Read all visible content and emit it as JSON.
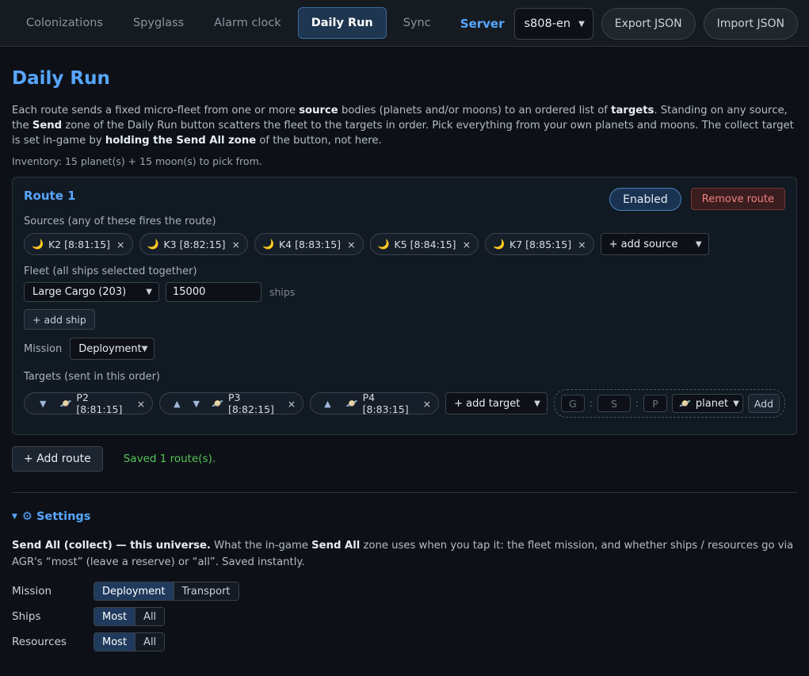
{
  "nav": {
    "tabs": [
      {
        "label": "Colonizations",
        "active": false
      },
      {
        "label": "Spyglass",
        "active": false
      },
      {
        "label": "Alarm clock",
        "active": false
      },
      {
        "label": "Daily Run",
        "active": true
      },
      {
        "label": "Sync",
        "active": false
      }
    ],
    "server_label": "Server",
    "server_value": "s808-en",
    "export_label": "Export JSON",
    "import_label": "Import JSON"
  },
  "page": {
    "title": "Daily Run",
    "intro": {
      "p1": "Each route sends a fixed micro-fleet from one or more ",
      "b1": "source",
      "p2": " bodies (planets and/or moons) to an ordered list of ",
      "b2": "targets",
      "p3": ". Standing on any source, the ",
      "b3": "Send",
      "p4": " zone of the Daily Run button scatters the fleet to the targets in order. Pick everything from your own planets and moons. The collect target is set in-game by ",
      "b4": "holding the Send All zone",
      "p5": " of the button, not here."
    },
    "inventory": "Inventory: 15 planet(s) + 15 moon(s) to pick from."
  },
  "route": {
    "title": "Route 1",
    "enabled_label": "Enabled",
    "remove_label": "Remove route",
    "sources_label": "Sources (any of these fires the route)",
    "sources": [
      {
        "label": "K2 [8:81:15]",
        "icon": "moon-icon"
      },
      {
        "label": "K3 [8:82:15]",
        "icon": "moon-icon"
      },
      {
        "label": "K4 [8:83:15]",
        "icon": "moon-icon"
      },
      {
        "label": "K5 [8:84:15]",
        "icon": "moon-icon"
      },
      {
        "label": "K7 [8:85:15]",
        "icon": "moon-icon"
      }
    ],
    "add_source_label": "+ add source",
    "fleet_label": "Fleet (all ships selected together)",
    "ship_type": "Large Cargo (203)",
    "ship_count": "15000",
    "ships_unit": "ships",
    "add_ship_label": "+ add ship",
    "mission_label": "Mission",
    "mission_value": "Deployment",
    "targets_label": "Targets (sent in this order)",
    "targets": [
      {
        "label": "P2 [8:81:15]",
        "icon": "planet-icon",
        "up": false,
        "down": true
      },
      {
        "label": "P3 [8:82:15]",
        "icon": "planet-icon",
        "up": true,
        "down": true
      },
      {
        "label": "P4 [8:83:15]",
        "icon": "planet-icon",
        "up": true,
        "down": false
      }
    ],
    "add_target_label": "+ add target",
    "coord_placeholders": {
      "g": "G",
      "s": "S",
      "p": "P"
    },
    "coord_type": "planet",
    "coord_add_label": "Add",
    "close_symbol": "×",
    "up_symbol": "▲",
    "down_symbol": "▼",
    "moon_glyph": "🌙",
    "planet_glyph": "🪐"
  },
  "actions": {
    "add_route_label": "+ Add route",
    "saved_text": "Saved 1 route(s)."
  },
  "settings": {
    "summary": "⚙ Settings",
    "desc_b1": "Send All (collect) — this universe.",
    "desc_p1": " What the in-game ",
    "desc_b2": "Send All",
    "desc_p2": " zone uses when you tap it: the fleet mission, and whether ships / resources go via AGR's “most” (leave a reserve) or “all”. Saved instantly.",
    "rows": [
      {
        "label": "Mission",
        "options": [
          "Deployment",
          "Transport"
        ],
        "selected": "Deployment"
      },
      {
        "label": "Ships",
        "options": [
          "Most",
          "All"
        ],
        "selected": "Most"
      },
      {
        "label": "Resources",
        "options": [
          "Most",
          "All"
        ],
        "selected": "Most"
      }
    ]
  }
}
